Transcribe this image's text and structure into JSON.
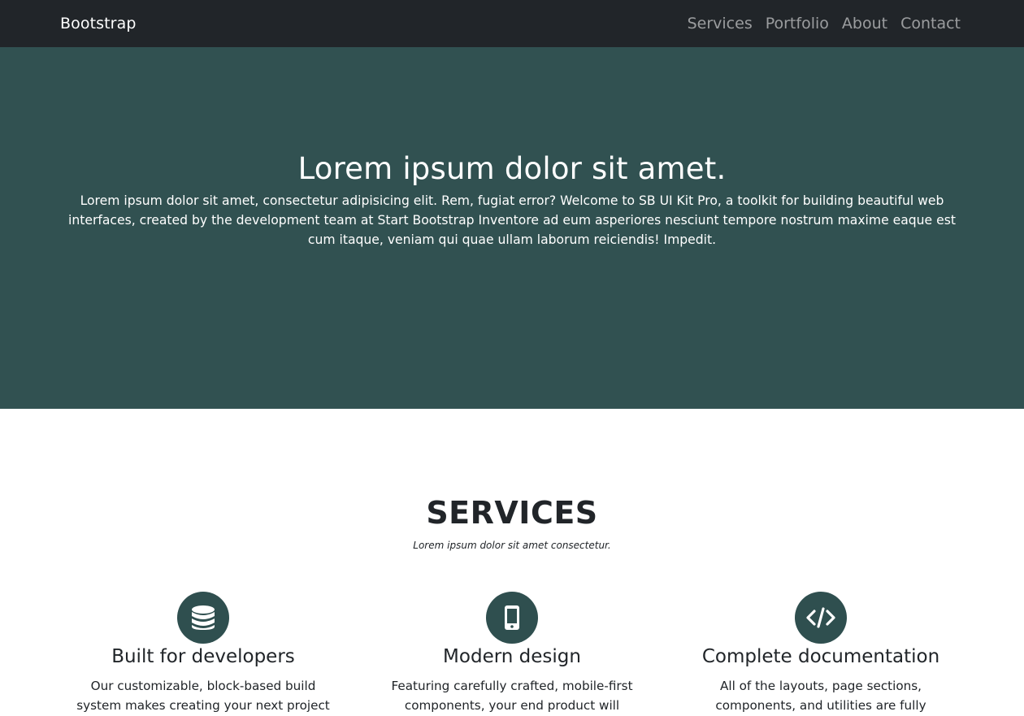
{
  "navbar": {
    "brand": "Bootstrap",
    "links": [
      "Services",
      "Portfolio",
      "About",
      "Contact"
    ]
  },
  "hero": {
    "title": "Lorem ipsum dolor sit amet.",
    "text": "Lorem ipsum dolor sit amet, consectetur adipisicing elit. Rem, fugiat error? Welcome to SB UI Kit Pro, a toolkit for building beautiful web interfaces, created by the development team at Start Bootstrap Inventore ad eum asperiores nesciunt tempore nostrum maxime eaque est cum itaque, veniam qui quae ullam laborum reiciendis! Impedit.",
    "background_color": "#315151"
  },
  "services": {
    "title": "SERVICES",
    "subtitle": "Lorem ipsum dolor sit amet consectetur.",
    "items": [
      {
        "icon": "database-icon",
        "title": "Built for developers",
        "text": "Our customizable, block-based build system makes creating your next project fast and"
      },
      {
        "icon": "mobile-phone-icon",
        "title": "Modern design",
        "text": "Featuring carefully crafted, mobile-first components, your end product will function"
      },
      {
        "icon": "code-icon",
        "title": "Complete documentation",
        "text": "All of the layouts, page sections, components, and utilities are fully covered in"
      }
    ]
  }
}
